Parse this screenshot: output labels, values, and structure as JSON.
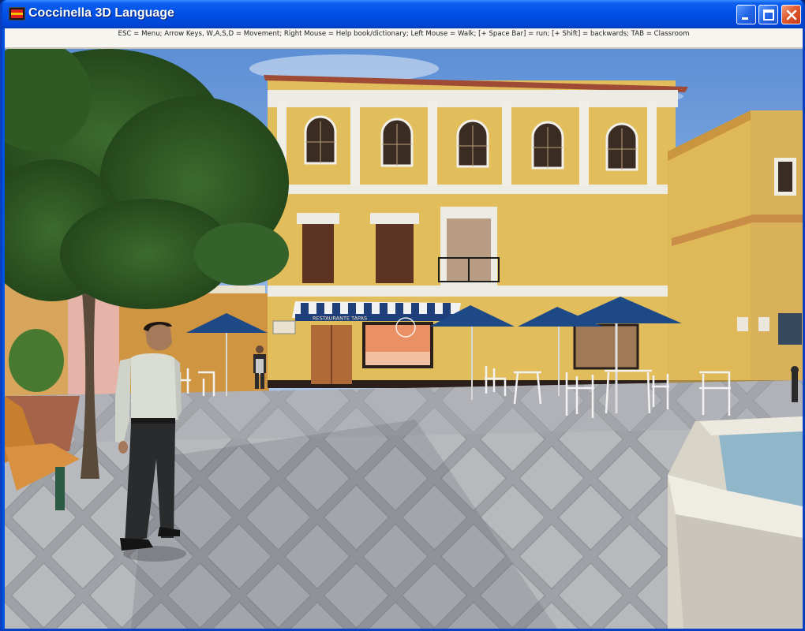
{
  "window": {
    "title": "Coccinella 3D Language",
    "controls": {
      "minimize": "minimize",
      "maximize": "maximize",
      "close": "close"
    }
  },
  "help_bar": {
    "text": "ESC = Menu;   Arrow Keys, W,A,S,D = Movement;   Right Mouse = Help book/dictionary;   Left Mouse = Walk; [+ Space Bar] = run; [+ Shift] = backwards;   TAB = Classroom"
  },
  "scene": {
    "restaurant_sign": "RESTAURANTE TAPAS",
    "colors": {
      "sky": "#7aa6dd",
      "building_facade": "#e2bd5c",
      "trim": "#f1efe6",
      "umbrella": "#1d4a86",
      "pavement": "#b6b8bc"
    }
  }
}
